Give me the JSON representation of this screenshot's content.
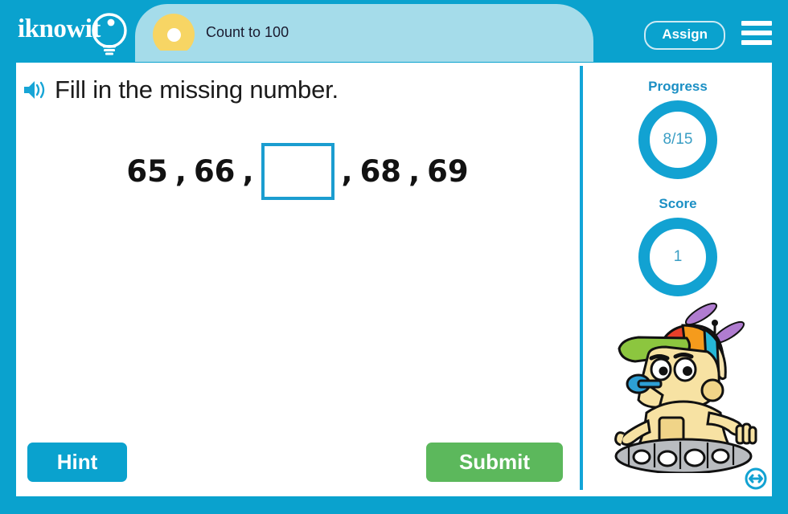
{
  "header": {
    "logo_text": "iknowit",
    "logo_icon": "lightbulb-icon",
    "lesson_title": "Count to 100",
    "assign_label": "Assign",
    "menu_icon": "hamburger-menu-icon"
  },
  "question": {
    "audio_icon": "speaker-icon",
    "prompt": "Fill in the missing number."
  },
  "sequence": {
    "items": [
      {
        "type": "number",
        "value": "65"
      },
      {
        "type": "comma",
        "value": ","
      },
      {
        "type": "number",
        "value": "66"
      },
      {
        "type": "comma",
        "value": ","
      },
      {
        "type": "input",
        "value": "",
        "placeholder": ""
      },
      {
        "type": "comma",
        "value": ","
      },
      {
        "type": "number",
        "value": "68"
      },
      {
        "type": "comma",
        "value": ","
      },
      {
        "type": "number",
        "value": "69"
      }
    ]
  },
  "rail": {
    "progress_label": "Progress",
    "progress_value": "8/15",
    "score_label": "Score",
    "score_value": "1",
    "mascot_icon": "robot-mascot-propeller-hat",
    "resize_icon": "resize-horizontal-icon"
  },
  "actions": {
    "hint_label": "Hint",
    "submit_label": "Submit"
  },
  "colors": {
    "brand_blue": "#0aa2ce",
    "tab_blue": "#a5dcea",
    "accent_yellow": "#f7d564",
    "ring_blue": "#12a2d2",
    "submit_green": "#5cb85c",
    "input_border": "#1b9dd0"
  }
}
